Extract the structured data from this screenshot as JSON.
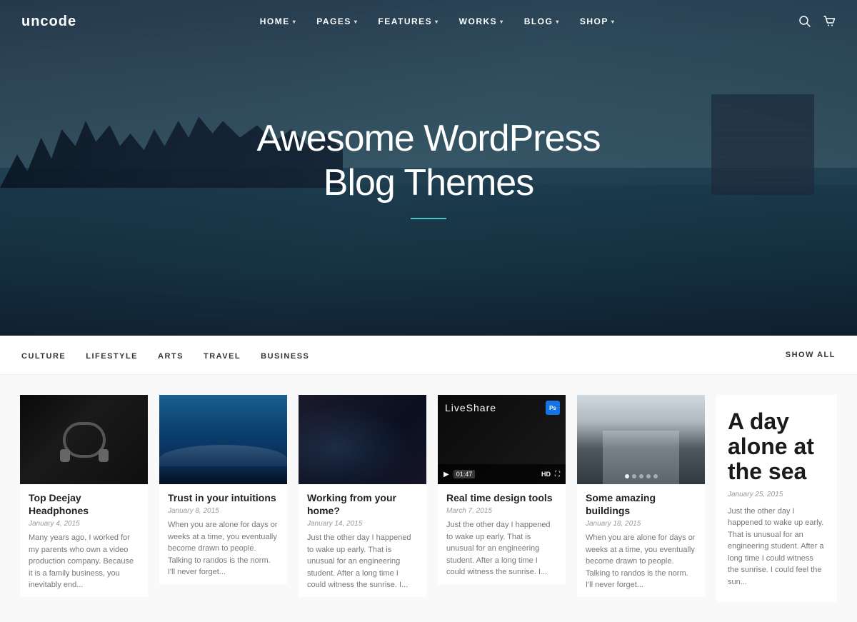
{
  "brand": "uncode",
  "nav": {
    "items": [
      {
        "label": "HOME",
        "has_dropdown": true
      },
      {
        "label": "PAGES",
        "has_dropdown": true
      },
      {
        "label": "FEATURES",
        "has_dropdown": true
      },
      {
        "label": "WORKS",
        "has_dropdown": true
      },
      {
        "label": "BLOG",
        "has_dropdown": true
      },
      {
        "label": "SHOP",
        "has_dropdown": true
      }
    ]
  },
  "hero": {
    "title_line1": "Awesome WordPress",
    "title_line2": "Blog Themes"
  },
  "category_bar": {
    "tabs": [
      {
        "label": "CULTURE"
      },
      {
        "label": "LIFESTYLE"
      },
      {
        "label": "ARTS"
      },
      {
        "label": "TRAVEL"
      },
      {
        "label": "BUSINESS"
      }
    ],
    "show_all": "SHOW ALL"
  },
  "posts": [
    {
      "id": "headphones",
      "title": "Top Deejay Headphones",
      "date": "January 4, 2015",
      "excerpt": "Many years ago, I worked for my parents who own a video production company. Because it is a family business, you inevitably end..."
    },
    {
      "id": "waves",
      "title": "Trust in your intuitions",
      "date": "January 8, 2015",
      "excerpt": "When you are alone for days or weeks at a time, you eventually become drawn to people. Talking to randos is the norm. I'll never forget..."
    },
    {
      "id": "laptop",
      "title": "Working from your home?",
      "date": "January 14, 2015",
      "excerpt": "Just the other day I happened to wake up early. That is unusual for an engineering student. After a long time I could witness the sunrise. I..."
    },
    {
      "id": "video",
      "title": "Real time design tools",
      "date": "March 7, 2015",
      "video_label": "LiveShare",
      "video_time": "01:47",
      "excerpt": "Just the other day I happened to wake up early. That is unusual for an engineering student. After a long time I could witness the sunrise. I..."
    },
    {
      "id": "buildings",
      "title": "Some amazing buildings",
      "date": "January 18, 2015",
      "excerpt": "When you are alone for days or weeks at a time, you eventually become drawn to people. Talking to randos is the norm. I'll never forget..."
    },
    {
      "id": "text",
      "title": "A day alone at the sea",
      "date": "January 25, 2015",
      "excerpt": "Just the other day I happened to wake up early. That is unusual for an engineering student. After a long time I could witness the sunrise. I could feel the sun..."
    }
  ]
}
